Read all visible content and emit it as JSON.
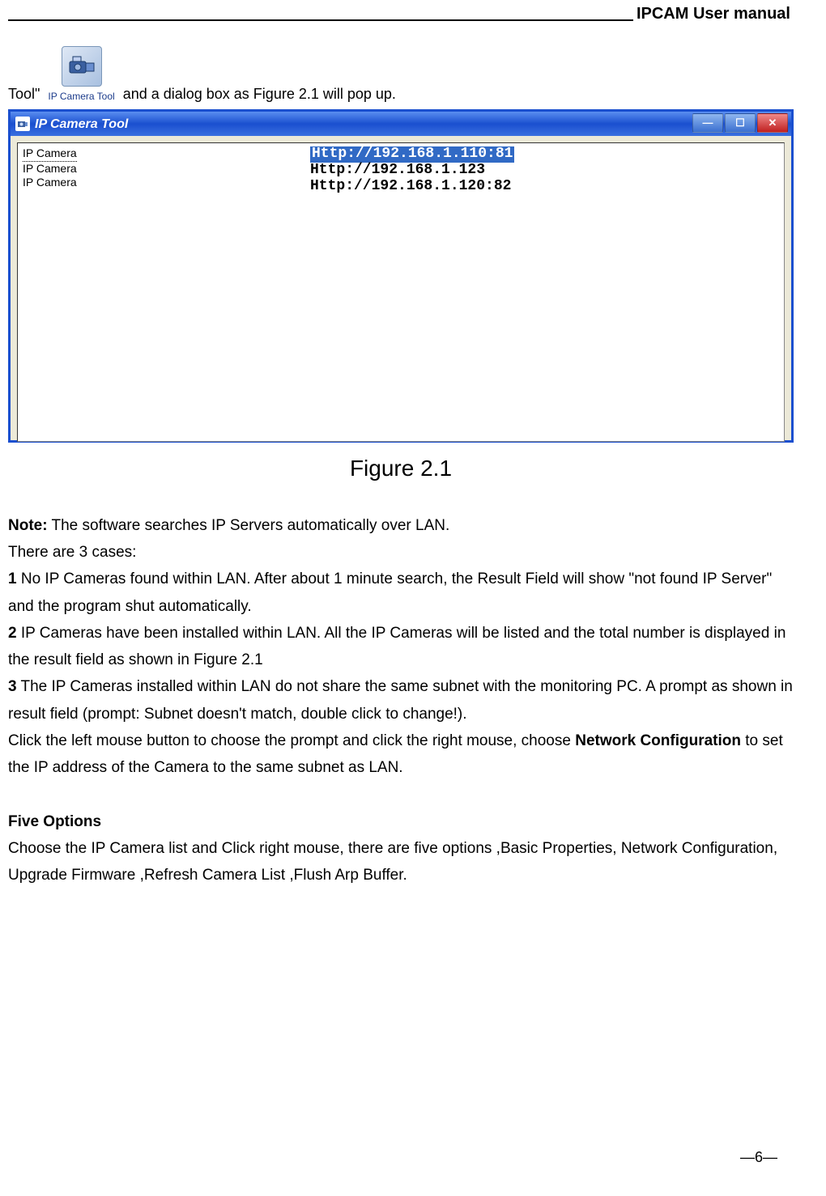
{
  "header": {
    "title": "IPCAM User manual"
  },
  "intro": {
    "pre": "Tool\"",
    "icon_label": "IP Camera Tool",
    "post": "and a dialog box as Figure 2.1 will pop up."
  },
  "window": {
    "title": "IP Camera Tool",
    "rows": [
      {
        "name": "IP Camera",
        "url": "Http://192.168.1.110:81",
        "selected": true
      },
      {
        "name": "IP Camera",
        "url": "Http://192.168.1.123",
        "selected": false
      },
      {
        "name": "IP Camera",
        "url": "Http://192.168.1.120:82",
        "selected": false
      }
    ]
  },
  "figure_caption": "Figure 2.1",
  "body": {
    "note_label": "Note:",
    "note_text": " The software searches IP Servers automatically over LAN.",
    "cases_intro": "There are 3 cases:",
    "case1_num": "1",
    "case1_text": " No IP Cameras found within LAN. After about 1 minute search, the Result Field will show \"not found IP Server\" and the program shut automatically.",
    "case2_num": "2",
    "case2_text": " IP Cameras have been installed within LAN. All the IP Cameras will be listed and the total number is displayed in the result field as shown in Figure 2.1",
    "case3_num": "3",
    "case3_text": " The IP Cameras installed within LAN do not share the same subnet with the monitoring PC. A prompt as shown in result field (prompt: Subnet doesn't match, double click to change!).",
    "click_text_pre": "Click the left mouse button to choose the prompt and click the right mouse, choose ",
    "netconf_label": "Network Configuration",
    "click_text_post": " to set the IP address of the Camera to the same subnet as LAN.",
    "five_options_heading": "Five Options",
    "five_options_text": "Choose the IP Camera list and Click right mouse, there are five options ,Basic Properties, Network Configuration, Upgrade Firmware ,Refresh Camera List ,Flush Arp Buffer."
  },
  "footer": {
    "page": "—6—"
  }
}
